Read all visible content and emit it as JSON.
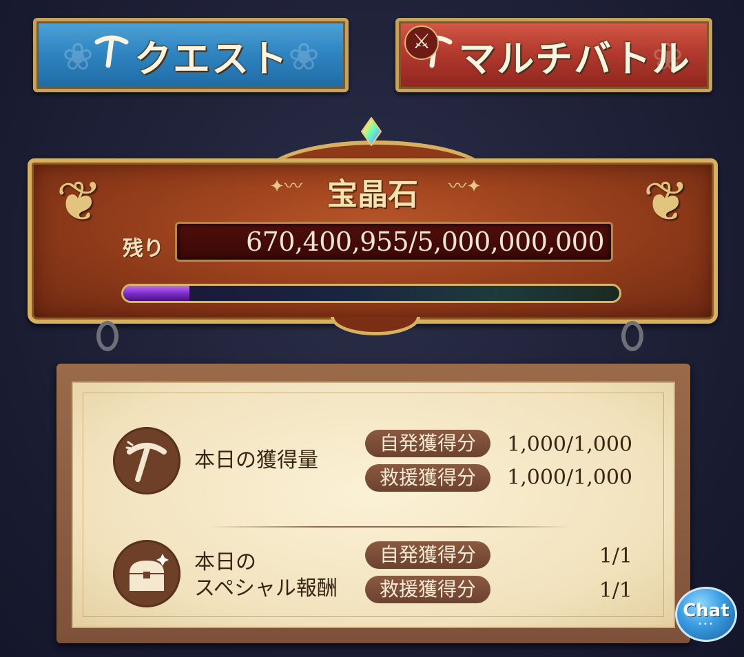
{
  "top_buttons": {
    "quest": {
      "label": "クエスト",
      "icon": "pickaxe-icon"
    },
    "multi": {
      "label": "マルチバトル",
      "icon": "pickaxe-icon",
      "badge_icon": "crossed-swords-icon"
    }
  },
  "plaque": {
    "title": "宝晶石",
    "remain_label": "残り",
    "remain_value": "670,400,955/5,000,000,000",
    "progress_fraction": 0.134,
    "gem_icon": "rainbow-crystal-icon"
  },
  "board": {
    "daily": {
      "icon": "pickaxe-icon",
      "title": "本日の獲得量",
      "rows": [
        {
          "label": "自発獲得分",
          "value": "1,000/1,000"
        },
        {
          "label": "救援獲得分",
          "value": "1,000/1,000"
        }
      ]
    },
    "special": {
      "icon": "treasure-chest-icon",
      "title_line1": "本日の",
      "title_line2": "スペシャル報酬",
      "rows": [
        {
          "label": "自発獲得分",
          "value": "1/1"
        },
        {
          "label": "救援獲得分",
          "value": "1/1"
        }
      ]
    }
  },
  "chat": {
    "label": "Chat",
    "dots": "•••"
  },
  "colors": {
    "quest_blue": "#2f86c2",
    "multi_red": "#b33a2e",
    "gold_trim": "#d8b062",
    "progress_purple": "#7c2dcc"
  }
}
